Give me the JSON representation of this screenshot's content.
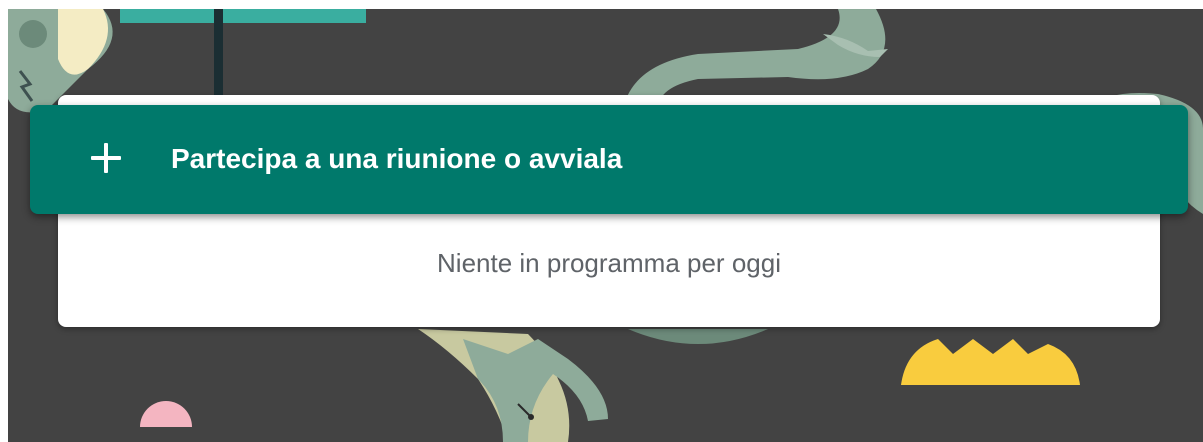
{
  "main": {
    "join_button_label": "Partecipa a una riunione o avviala",
    "empty_schedule_text": "Niente in programma per oggi"
  },
  "icons": {
    "join": "plus-icon"
  },
  "colors": {
    "background": "#434343",
    "button": "#00796b",
    "button_text": "#ffffff",
    "card": "#ffffff",
    "muted_text": "#5f6368",
    "accent_teal": "#3aaea0",
    "accent_yellow": "#f9cc3e",
    "accent_pink": "#f4b5c1",
    "illustration_green": "#8eab9a",
    "illustration_cream": "#f4ecc4"
  }
}
